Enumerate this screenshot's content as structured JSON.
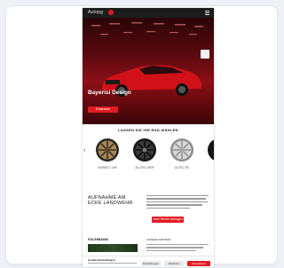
{
  "header": {
    "brand": "Autopg"
  },
  "hero": {
    "title": "Bayerisi Design",
    "cta_label": "Entdecken"
  },
  "wheels_section": {
    "title": "LASSEN SIE IHR RAD WÄHLEN",
    "items": [
      {
        "label": "BORBET CW5"
      },
      {
        "label": "ALUTEC GRIP"
      },
      {
        "label": "AUTEC RX"
      }
    ]
  },
  "promo": {
    "title": "AUFNAHME AM ECKE LANDWEHR",
    "cta_label": "Jetzt Termin anfragen"
  },
  "bottom": {
    "title": "FACHMANN",
    "right_title": "UNSERE PARTNER"
  },
  "cookie": {
    "title": "Cookie-Einstellungen",
    "btn_settings": "Einstellungen",
    "btn_reject": "Ablehnen",
    "btn_accept": "Akzeptieren"
  },
  "colors": {
    "accent": "#e21a22",
    "dark": "#1c1c1c"
  }
}
